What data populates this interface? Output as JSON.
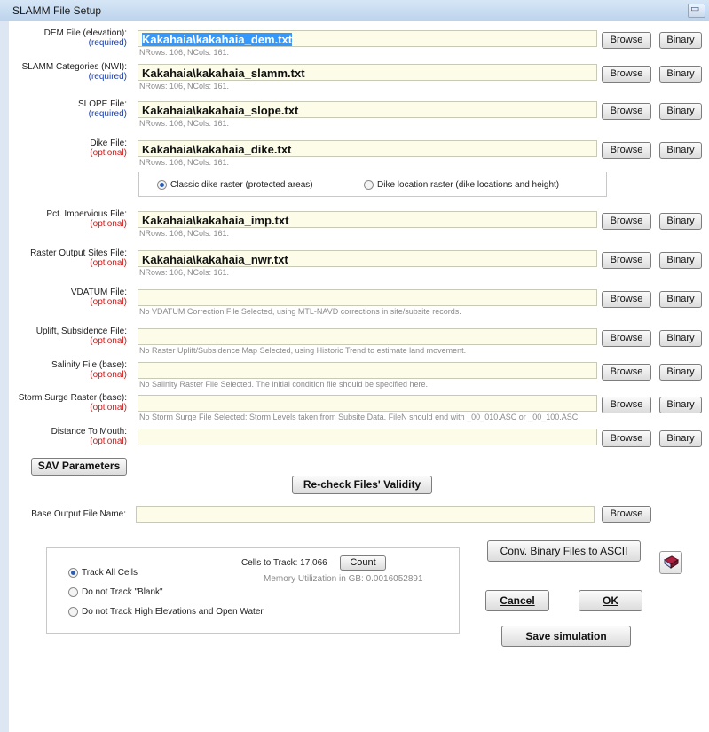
{
  "window": {
    "title": "SLAMM File Setup"
  },
  "browse_label": "Browse",
  "binary_label": "Binary",
  "rows": [
    {
      "label": "DEM File (elevation):",
      "status": "(required)",
      "status_type": "required",
      "value": "Kakahaia\\kakahaia_dem.txt",
      "info": "NRows: 106, NCols: 161."
    },
    {
      "label": "SLAMM Categories (NWI):",
      "status": "(required)",
      "status_type": "required",
      "value": "Kakahaia\\kakahaia_slamm.txt",
      "info": "NRows: 106, NCols: 161."
    },
    {
      "label": "SLOPE File:",
      "status": "(required)",
      "status_type": "required",
      "value": "Kakahaia\\kakahaia_slope.txt",
      "info": "NRows: 106, NCols: 161."
    },
    {
      "label": "Dike File:",
      "status": "(optional)",
      "status_type": "optional",
      "value": "Kakahaia\\kakahaia_dike.txt",
      "info": "NRows: 106, NCols: 161."
    },
    {
      "label": "Pct. Impervious File:",
      "status": "(optional)",
      "status_type": "optional",
      "value": "Kakahaia\\kakahaia_imp.txt",
      "info": "NRows: 106, NCols: 161."
    },
    {
      "label": "Raster Output Sites File:",
      "status": "(optional)",
      "status_type": "optional",
      "value": "Kakahaia\\kakahaia_nwr.txt",
      "info": "NRows: 106, NCols: 161."
    },
    {
      "label": "VDATUM File:",
      "status": "(optional)",
      "status_type": "optional",
      "value": "",
      "info": "No VDATUM Correction File Selected, using MTL-NAVD corrections in site/subsite records."
    },
    {
      "label": "Uplift, Subsidence File:",
      "status": "(optional)",
      "status_type": "optional",
      "value": "",
      "info": "No Raster Uplift/Subsidence Map Selected, using Historic Trend to estimate land movement."
    },
    {
      "label": "Salinity File (base):",
      "status": "(optional)",
      "status_type": "optional",
      "value": "",
      "info": "No Salinity Raster File Selected.  The initial condition file should be specified here."
    },
    {
      "label": "Storm Surge Raster (base):",
      "status": "(optional)",
      "status_type": "optional",
      "value": "",
      "info": "No Storm Surge File Selected: Storm Levels taken from Subsite Data.  FileN should end with _00_010.ASC or _00_100.ASC"
    },
    {
      "label": "Distance To Mouth:",
      "status": "(optional)",
      "status_type": "optional",
      "value": "",
      "info": ""
    }
  ],
  "dike_options": {
    "classic": "Classic dike raster (protected areas)",
    "location": "Dike location raster (dike locations and height)",
    "selected": "classic"
  },
  "sav_button": "SAV Parameters",
  "recheck_button": "Re-check Files' Validity",
  "base_output": {
    "label": "Base Output File Name:",
    "value": ""
  },
  "tracking": {
    "options": [
      "Track All Cells",
      "Do not Track \"Blank\"",
      "Do not Track High Elevations and Open Water"
    ],
    "selected_index": 0,
    "cells_label": "Cells to Track: 17,066",
    "count_button": "Count",
    "memory_label": "Memory Utilization in GB: 0.0016052891"
  },
  "conv_button": "Conv. Binary Files to ASCII",
  "help_icon": "book-icon",
  "cancel_button": "Cancel",
  "ok_button": "OK",
  "save_button": "Save simulation"
}
